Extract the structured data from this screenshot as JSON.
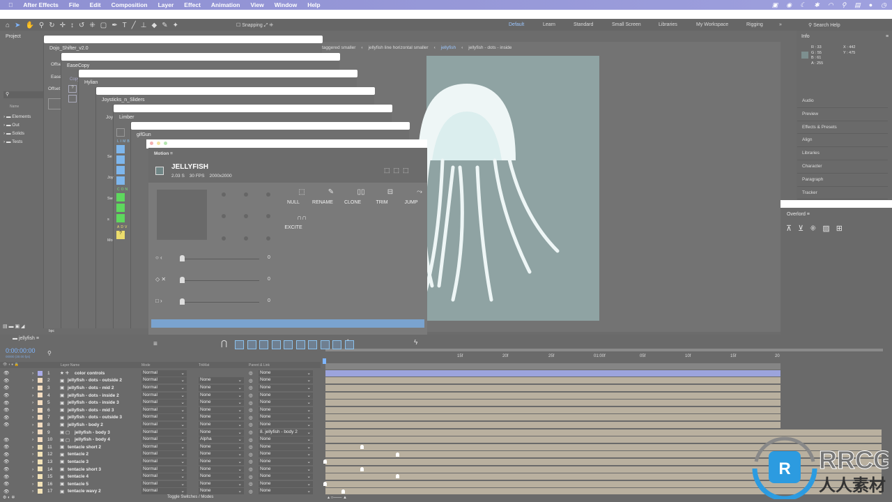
{
  "menubar": {
    "app": "After Effects",
    "items": [
      "File",
      "Edit",
      "Composition",
      "Layer",
      "Effect",
      "Animation",
      "View",
      "Window",
      "Help"
    ]
  },
  "toolbar": {
    "snapping": "Snapping"
  },
  "workspaces": [
    "Default",
    "Learn",
    "Standard",
    "Small Screen",
    "Libraries",
    "My Workspace",
    "Rigging"
  ],
  "search_help": "Search Help",
  "project": {
    "title": "Project",
    "column": "Name",
    "folders": [
      "Elements",
      "Out",
      "Solids",
      "Tests"
    ],
    "bpc": "8 bpc"
  },
  "floating": {
    "dojo": "Dojo_Shifter_v2.0",
    "easecopy": "EaseCopy",
    "hylian": "Hylian",
    "joysticks": "Joysticks_n_Sliders",
    "limber": "Limber",
    "gifgun": "gifGun",
    "dojo_offset": "Offset",
    "dojo_ease": "Ease",
    "dojo_offset2": "Offset",
    "ec_copy": "Copy",
    "joy_tab": "Joy",
    "limber_sections": [
      "LIMB",
      "CON",
      "ADV"
    ],
    "limber_labels": [
      "Se",
      "Joy",
      "Sw",
      "s",
      "Mo"
    ]
  },
  "breadcrumb": [
    "taggered smaller",
    "jellyfish line horizontal smaller",
    "jellyfish",
    "jellyfish - dots - inside"
  ],
  "info": {
    "title": "Info",
    "r": "R : 33",
    "g": "G : 55",
    "b": "B : 61",
    "a": "A : 255",
    "x": "X : 442",
    "y": "Y : 475",
    "swatch": "#7d8f8f"
  },
  "right_panels": [
    "Audio",
    "Preview",
    "Effects & Presets",
    "Align",
    "Libraries",
    "Character",
    "Paragraph",
    "Tracker"
  ],
  "overlord": {
    "title": "Overlord"
  },
  "motion": {
    "tab": "Motion",
    "comp_name": "JELLYFISH",
    "duration": "2.03 S",
    "fps": "30 FPS",
    "size": "2000x2000",
    "buttons": [
      "NULL",
      "RENAME",
      "CLONE",
      "TRIM",
      "JUMP",
      "EXCITE"
    ],
    "sliders": [
      "0",
      "0",
      "0"
    ]
  },
  "timeline": {
    "comp": "jellyfish",
    "timecode": "0:00:00:00",
    "fps": "00000 (30.00 fps)",
    "columns": {
      "name": "Layer Name",
      "mode": "Mode",
      "trkmat": "TrkMat",
      "parent": "Parent & Link"
    },
    "toggle": "Toggle Switches / Modes",
    "ruler": [
      "15f",
      "20f",
      "25f",
      "01:00f",
      "05f",
      "10f",
      "15f",
      "20"
    ],
    "layers": [
      {
        "n": "1",
        "name": "color controls",
        "mode": "Normal",
        "trk": "",
        "parent": "None",
        "color": "#a9abe8"
      },
      {
        "n": "2",
        "name": "jellyfish - dots - outside 2",
        "mode": "Normal",
        "trk": "None",
        "parent": "None",
        "color": "#f3dcc0"
      },
      {
        "n": "3",
        "name": "jellyfish - dots - mid 2",
        "mode": "Normal",
        "trk": "None",
        "parent": "None",
        "color": "#f3dcc0"
      },
      {
        "n": "4",
        "name": "jellyfish - dots - inside 2",
        "mode": "Normal",
        "trk": "None",
        "parent": "None",
        "color": "#f3dcc0"
      },
      {
        "n": "5",
        "name": "jellyfish - dots - inside 3",
        "mode": "Normal",
        "trk": "None",
        "parent": "None",
        "color": "#f3dcc0"
      },
      {
        "n": "6",
        "name": "jellyfish - dots - mid 3",
        "mode": "Normal",
        "trk": "None",
        "parent": "None",
        "color": "#f3dcc0"
      },
      {
        "n": "7",
        "name": "jellyfish - dots - outside 3",
        "mode": "Normal",
        "trk": "None",
        "parent": "None",
        "color": "#f3dcc0"
      },
      {
        "n": "8",
        "name": "jellyfish - body 2",
        "mode": "Normal",
        "trk": "None",
        "parent": "None",
        "color": "#f3dcc0"
      },
      {
        "n": "9",
        "name": "jellyfish - body 3",
        "mode": "Normal",
        "trk": "None",
        "parent": "8. jellyfish - body 2",
        "color": "#f3dcc0"
      },
      {
        "n": "10",
        "name": "jellyfish - body 4",
        "mode": "Normal",
        "trk": "Alpha",
        "parent": "None",
        "color": "#f3dcc0"
      },
      {
        "n": "11",
        "name": "tentacle short 2",
        "mode": "Normal",
        "trk": "None",
        "parent": "None",
        "color": "#f3e3b8"
      },
      {
        "n": "12",
        "name": "tentacle 2",
        "mode": "Normal",
        "trk": "None",
        "parent": "None",
        "color": "#f3e3b8"
      },
      {
        "n": "13",
        "name": "tentacle 3",
        "mode": "Normal",
        "trk": "None",
        "parent": "None",
        "color": "#f3e3b8"
      },
      {
        "n": "14",
        "name": "tentacle short 3",
        "mode": "Normal",
        "trk": "None",
        "parent": "None",
        "color": "#f3e3b8"
      },
      {
        "n": "15",
        "name": "tentacle 4",
        "mode": "Normal",
        "trk": "None",
        "parent": "None",
        "color": "#f3e3b8"
      },
      {
        "n": "16",
        "name": "tentacle 5",
        "mode": "Normal",
        "trk": "None",
        "parent": "None",
        "color": "#f3e3b8"
      },
      {
        "n": "17",
        "name": "tentacle wavy 2",
        "mode": "Normal",
        "trk": "None",
        "parent": "None",
        "color": "#f3e3b8"
      }
    ]
  },
  "watermark": {
    "text": "RRCG",
    "sub": "人人素材"
  }
}
